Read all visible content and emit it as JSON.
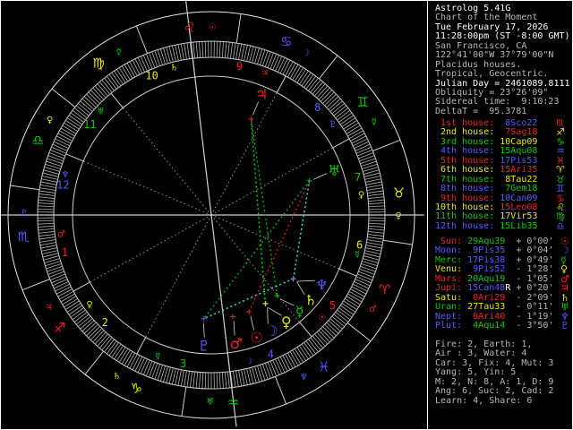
{
  "colors": {
    "red": "#ee2222",
    "yellow": "#e8e800",
    "green": "#00cc00",
    "blue": "#5a5aff",
    "white": "#ffffff",
    "gray": "#b8b8b8",
    "cyan": "#33dddd",
    "line": "#cccccc",
    "bright_line": "#e8e8e8",
    "dim_line": "#979797",
    "tick": "#b4b4b4",
    "connector": "#d0d0d0"
  },
  "panel": {
    "header": [
      {
        "text": "Astrolog 5.41G",
        "tone": "white"
      },
      {
        "text": "Chart of the Moment",
        "tone": "gray"
      },
      {
        "text": "Tue February 17, 2026",
        "tone": "white"
      },
      {
        "text": "11:28:00pm (ST -8:00 GMT)",
        "tone": "white"
      },
      {
        "text": "San Francisco, CA",
        "tone": "gray"
      },
      {
        "text": "122°41'00\"W 37°79'00\"N",
        "tone": "gray"
      },
      {
        "text": "Placidus houses.",
        "tone": "gray"
      },
      {
        "text": "Tropical, Geocentric.",
        "tone": "gray"
      },
      {
        "text": "Julian Day = 2461089.8111",
        "tone": "white"
      },
      {
        "text": "Obliquity = 23°26'09\"",
        "tone": "gray"
      },
      {
        "text": "Sidereal time:  9:10:23",
        "tone": "gray"
      },
      {
        "text": "DeltaT =  95.3781",
        "tone": "gray"
      }
    ],
    "house_word": "house:",
    "houses": [
      {
        "label": " 1st",
        "label_color": "red",
        "pos": " 8Sco22",
        "pos_color": "blue",
        "glyph": "♏",
        "glyph_color": "red"
      },
      {
        "label": " 2nd",
        "label_color": "yellow",
        "pos": " 7Sag18",
        "pos_color": "red",
        "glyph": "♐",
        "glyph_color": "yellow"
      },
      {
        "label": " 3rd",
        "label_color": "green",
        "pos": "10Cap09",
        "pos_color": "yellow",
        "glyph": "♑",
        "glyph_color": "green"
      },
      {
        "label": " 4th",
        "label_color": "blue",
        "pos": "15Aqu08",
        "pos_color": "green",
        "glyph": "♒",
        "glyph_color": "blue"
      },
      {
        "label": " 5th",
        "label_color": "red",
        "pos": "17Pis53",
        "pos_color": "blue",
        "glyph": "♓",
        "glyph_color": "red"
      },
      {
        "label": " 6th",
        "label_color": "yellow",
        "pos": "15Ari35",
        "pos_color": "red",
        "glyph": "♈",
        "glyph_color": "yellow"
      },
      {
        "label": " 7th",
        "label_color": "green",
        "pos": " 8Tau22",
        "pos_color": "yellow",
        "glyph": "♉",
        "glyph_color": "green"
      },
      {
        "label": " 8th",
        "label_color": "blue",
        "pos": " 7Gem18",
        "pos_color": "green",
        "glyph": "♊",
        "glyph_color": "blue"
      },
      {
        "label": " 9th",
        "label_color": "red",
        "pos": "10Can09",
        "pos_color": "blue",
        "glyph": "♋",
        "glyph_color": "red"
      },
      {
        "label": "10th",
        "label_color": "yellow",
        "pos": "15Leo08",
        "pos_color": "red",
        "glyph": "♌",
        "glyph_color": "yellow"
      },
      {
        "label": "11th",
        "label_color": "green",
        "pos": "17Vir53",
        "pos_color": "yellow",
        "glyph": "♍",
        "glyph_color": "green"
      },
      {
        "label": "12th",
        "label_color": "blue",
        "pos": "15Lib35",
        "pos_color": "green",
        "glyph": "♎",
        "glyph_color": "blue"
      }
    ],
    "planets": [
      {
        "label": " Sun:",
        "color": "red",
        "pos": "29Aqu39",
        "pos_color": "green",
        "retro": " ",
        "vel": "+ 0°00'",
        "glyph": "☉"
      },
      {
        "label": "Moon:",
        "color": "blue",
        "pos": " 9Pis35",
        "pos_color": "blue",
        "retro": " ",
        "vel": "+ 0°04'",
        "glyph": "☽"
      },
      {
        "label": "Merc:",
        "color": "green",
        "pos": "17Pis38",
        "pos_color": "blue",
        "retro": " ",
        "vel": "+ 0°49'",
        "glyph": "☿"
      },
      {
        "label": "Venu:",
        "color": "yellow",
        "pos": " 9Pis52",
        "pos_color": "blue",
        "retro": " ",
        "vel": "- 1°28'",
        "glyph": "♀"
      },
      {
        "label": "Mars:",
        "color": "red",
        "pos": "20Aqu19",
        "pos_color": "green",
        "retro": " ",
        "vel": "- 1°05'",
        "glyph": "♂"
      },
      {
        "label": "Jupi:",
        "color": "red",
        "pos": "15Can48",
        "pos_color": "blue",
        "retro": "R",
        "vel": "+ 0°20'",
        "glyph": "♃"
      },
      {
        "label": "Satu:",
        "color": "yellow",
        "pos": " 0Ari29",
        "pos_color": "red",
        "retro": " ",
        "vel": "- 2°09'",
        "glyph": "♄"
      },
      {
        "label": "Uran:",
        "color": "green",
        "pos": "27Tau33",
        "pos_color": "yellow",
        "retro": " ",
        "vel": "- 0°11'",
        "glyph": "♅"
      },
      {
        "label": "Nept:",
        "color": "blue",
        "pos": " 0Ari40",
        "pos_color": "red",
        "retro": " ",
        "vel": "- 1°19'",
        "glyph": "♆"
      },
      {
        "label": "Plut:",
        "color": "blue",
        "pos": " 4Aqu14",
        "pos_color": "green",
        "retro": " ",
        "vel": "- 3°50'",
        "glyph": "♇"
      }
    ],
    "stats": [
      "Fire: 2, Earth: 1,",
      "Air : 3, Water: 4",
      "Car: 3, Fix: 4, Mut: 3",
      "Yang: 5, Yin: 5",
      "M: 2, N: 8, A: 1, D: 9",
      "Ang: 6, Suc: 2, Cad: 2",
      "Learn: 4, Share: 6"
    ]
  },
  "wheel": {
    "ascendant_lon": 218.37,
    "cusp_lons": [
      218.37,
      247.3,
      280.15,
      315.13,
      347.88,
      15.58,
      38.37,
      67.3,
      100.15,
      135.13,
      167.88,
      195.58
    ],
    "house_number_colors": [
      "red",
      "yellow",
      "green",
      "blue",
      "red",
      "yellow",
      "green",
      "blue",
      "red",
      "yellow",
      "green",
      "blue"
    ],
    "house_rulers": [
      "♂",
      "♀",
      "☿",
      "☽",
      "☉",
      "☿",
      "♀",
      "♇",
      "♃",
      "♄",
      "♅",
      "♆"
    ],
    "house_ruler_colors": [
      "red",
      "yellow",
      "green",
      "blue",
      "red",
      "green",
      "yellow",
      "blue",
      "red",
      "yellow",
      "green",
      "blue"
    ],
    "signs": [
      {
        "name": "Aries",
        "glyph": "♈",
        "color": "red",
        "ruler": "♂",
        "ruler_color": "red"
      },
      {
        "name": "Taurus",
        "glyph": "♉",
        "color": "yellow",
        "ruler": "♀",
        "ruler_color": "yellow"
      },
      {
        "name": "Gemini",
        "glyph": "♊",
        "color": "green",
        "ruler": "☿",
        "ruler_color": "green"
      },
      {
        "name": "Cancer",
        "glyph": "♋",
        "color": "blue",
        "ruler": "☽",
        "ruler_color": "blue"
      },
      {
        "name": "Leo",
        "glyph": "♌",
        "color": "red",
        "ruler": "☉",
        "ruler_color": "red"
      },
      {
        "name": "Virgo",
        "glyph": "♍",
        "color": "yellow",
        "ruler": "☿",
        "ruler_color": "green"
      },
      {
        "name": "Libra",
        "glyph": "♎",
        "color": "green",
        "ruler": "♀",
        "ruler_color": "yellow"
      },
      {
        "name": "Scorpio",
        "glyph": "♏",
        "color": "blue",
        "ruler": "♇",
        "ruler_color": "blue"
      },
      {
        "name": "Sagittarius",
        "glyph": "♐",
        "color": "red",
        "ruler": "♃",
        "ruler_color": "red"
      },
      {
        "name": "Capricorn",
        "glyph": "♑",
        "color": "yellow",
        "ruler": "♄",
        "ruler_color": "yellow"
      },
      {
        "name": "Aquarius",
        "glyph": "♒",
        "color": "green",
        "ruler": "♅",
        "ruler_color": "green"
      },
      {
        "name": "Pisces",
        "glyph": "♓",
        "color": "blue",
        "ruler": "♆",
        "ruler_color": "blue"
      }
    ],
    "planets": [
      {
        "name": "Sun",
        "glyph": "☉",
        "color": "red",
        "lon": 329.65,
        "display_phi": 290.3
      },
      {
        "name": "Moon",
        "glyph": "☽",
        "color": "blue",
        "lon": 339.58,
        "display_phi": 297.5
      },
      {
        "name": "Mercury",
        "glyph": "☿",
        "color": "green",
        "lon": 347.63,
        "display_phi": 312.5
      },
      {
        "name": "Venus",
        "glyph": "♀",
        "color": "yellow",
        "lon": 339.87,
        "display_phi": 305.0
      },
      {
        "name": "Mars",
        "glyph": "♂",
        "color": "red",
        "lon": 320.32,
        "display_phi": 281.0
      },
      {
        "name": "Jupiter",
        "glyph": "♃",
        "color": "red",
        "lon": 105.8,
        "display_phi": 67.4
      },
      {
        "name": "Saturn",
        "glyph": "♄",
        "color": "yellow",
        "lon": 0.48,
        "display_phi": 319.5
      },
      {
        "name": "Uranus",
        "glyph": "♅",
        "color": "green",
        "lon": 57.55,
        "display_phi": 19.8
      },
      {
        "name": "Neptune",
        "glyph": "♆",
        "color": "blue",
        "lon": 0.67,
        "display_phi": 327.7
      },
      {
        "name": "Pluto",
        "glyph": "♇",
        "color": "blue",
        "lon": 304.23,
        "display_phi": 266.8
      }
    ],
    "aspects": [
      {
        "a": "Moon",
        "b": "Jupiter",
        "type": "trine",
        "color": "green"
      },
      {
        "a": "Venus",
        "b": "Jupiter",
        "type": "trine",
        "color": "green"
      },
      {
        "a": "Mercury",
        "b": "Jupiter",
        "type": "trine",
        "color": "green"
      },
      {
        "a": "Uranus",
        "b": "Pluto",
        "type": "trine",
        "color": "green"
      },
      {
        "a": "Saturn",
        "b": "Uranus",
        "type": "sextile",
        "color": "cyan"
      },
      {
        "a": "Neptune",
        "b": "Uranus",
        "type": "sextile",
        "color": "cyan"
      },
      {
        "a": "Saturn",
        "b": "Pluto",
        "type": "sextile",
        "color": "cyan"
      },
      {
        "a": "Neptune",
        "b": "Pluto",
        "type": "sextile",
        "color": "cyan"
      },
      {
        "a": "Sun",
        "b": "Uranus",
        "type": "square",
        "color": "red"
      }
    ]
  }
}
